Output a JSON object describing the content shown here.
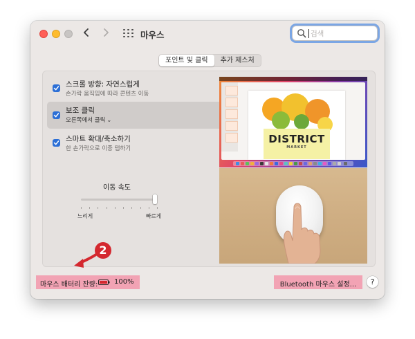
{
  "window": {
    "title": "마우스",
    "search": {
      "placeholder": "검색",
      "icon": "magnifier-icon"
    },
    "nav": {
      "back": "‹",
      "forward": "›"
    }
  },
  "tabs": [
    {
      "label": "포인트 및 클릭",
      "active": true
    },
    {
      "label": "추가 제스처",
      "active": false
    }
  ],
  "options": [
    {
      "title": "스크롤 방향: 자연스럽게",
      "subtitle": "손가락 움직임에 따라 콘텐츠 이동",
      "checked": true,
      "selected": false
    },
    {
      "title": "보조 클릭",
      "subtitle": "오른쪽에서 클릭",
      "checked": true,
      "selected": true,
      "has_dropdown": true
    },
    {
      "title": "스마트 확대/축소하기",
      "subtitle": "한 손가락으로 이중 탭하기",
      "checked": true,
      "selected": false
    }
  ],
  "tracking_speed": {
    "label": "이동 속도",
    "min_label": "느리게",
    "max_label": "빠르게",
    "value_fraction": 1.0,
    "tick_count": 10
  },
  "preview": {
    "slide_title": "DISTRICT",
    "slide_subtitle": "MARKET"
  },
  "bottom": {
    "battery_label": "마우스 배터리 잔량:",
    "battery_percent": "100%",
    "bluetooth_button": "Bluetooth 마우스 설정...",
    "help": "?"
  },
  "annotation": {
    "badge": "2",
    "color": "#d4282f"
  },
  "colors": {
    "accent": "#2c6fd6",
    "highlight": "#f2a3b4",
    "window_bg": "#ece8e6"
  }
}
